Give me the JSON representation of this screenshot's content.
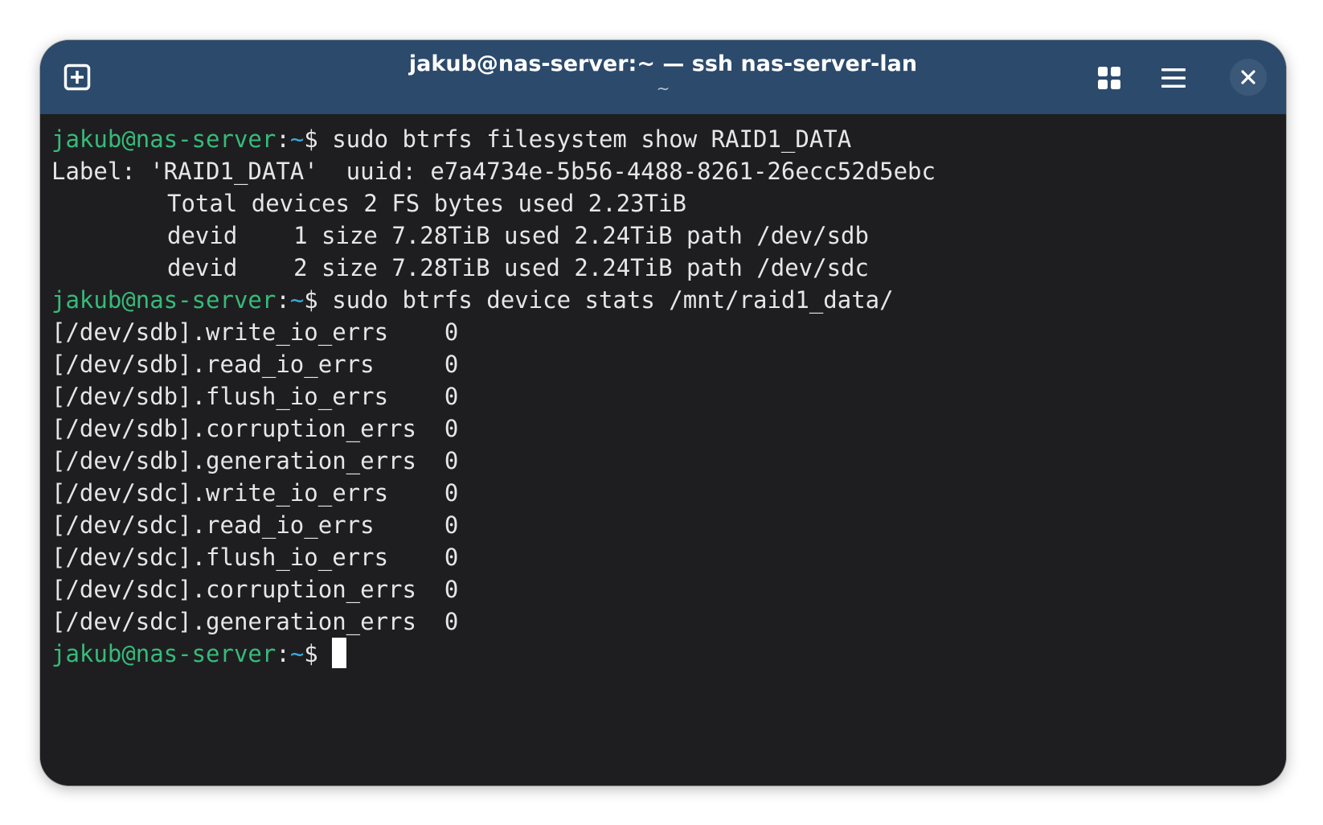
{
  "window": {
    "title": "jakub@nas-server:~ — ssh nas-server-lan",
    "subtitle": "~"
  },
  "icons": {
    "new_tab": "new-tab-icon",
    "grid": "grid-icon",
    "menu": "hamburger-menu-icon",
    "close": "close-icon"
  },
  "colors": {
    "titlebar": "#2c4a6b",
    "terminal_bg": "#1e1e20",
    "prompt_user": "#36bb7a",
    "prompt_path": "#3ba9e0",
    "text": "#e6e6e6"
  },
  "prompt": {
    "user_host": "jakub@nas-server",
    "colon": ":",
    "path": "~",
    "dollar": "$ "
  },
  "terminal": {
    "cmd1": "sudo btrfs filesystem show RAID1_DATA",
    "out1": [
      "Label: 'RAID1_DATA'  uuid: e7a4734e-5b56-4488-8261-26ecc52d5ebc",
      "\tTotal devices 2 FS bytes used 2.23TiB",
      "\tdevid    1 size 7.28TiB used 2.24TiB path /dev/sdb",
      "\tdevid    2 size 7.28TiB used 2.24TiB path /dev/sdc"
    ],
    "cmd2": "sudo btrfs device stats /mnt/raid1_data/",
    "out2": [
      "[/dev/sdb].write_io_errs    0",
      "[/dev/sdb].read_io_errs     0",
      "[/dev/sdb].flush_io_errs    0",
      "[/dev/sdb].corruption_errs  0",
      "[/dev/sdb].generation_errs  0",
      "[/dev/sdc].write_io_errs    0",
      "[/dev/sdc].read_io_errs     0",
      "[/dev/sdc].flush_io_errs    0",
      "[/dev/sdc].corruption_errs  0",
      "[/dev/sdc].generation_errs  0"
    ]
  }
}
